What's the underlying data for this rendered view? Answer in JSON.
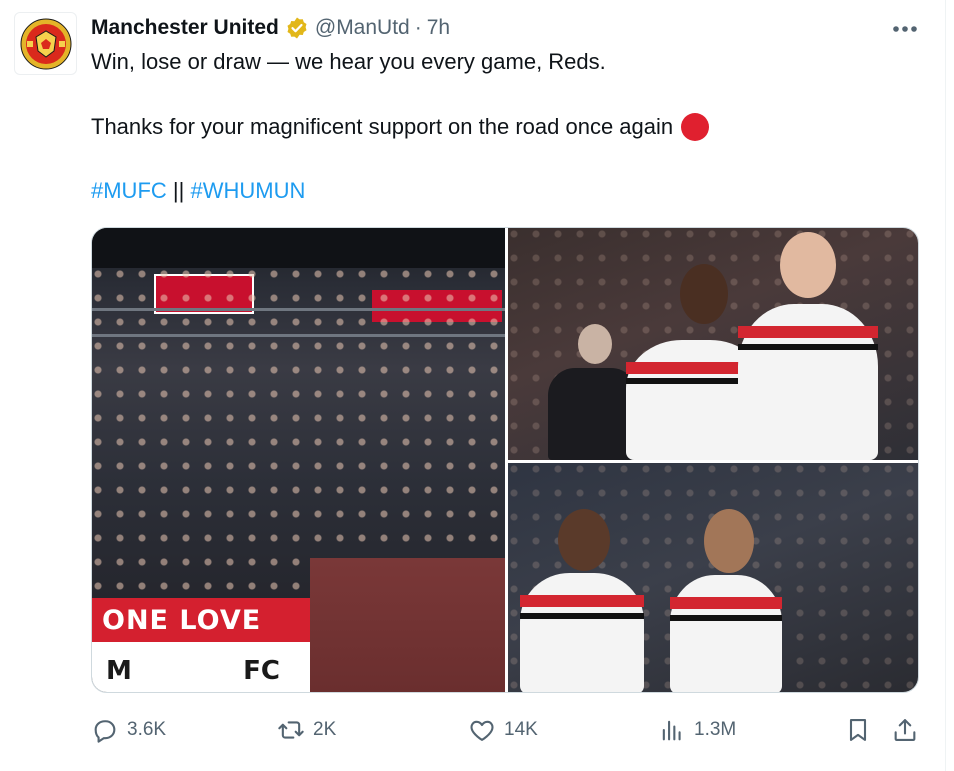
{
  "tweet": {
    "author_name": "Manchester United",
    "handle": "@ManUtd",
    "separator": "·",
    "time": "7h",
    "line1": "Win, lose or draw — we hear you every game, Reds.",
    "line2": "Thanks for your magnificent support on the road once again",
    "hashtag1": "#MUFC",
    "hashtag_separator": "||",
    "hashtag2": "#WHUMUN"
  },
  "media": {
    "banner_line1": "ONE LOVE",
    "banner_line2_left": "M",
    "banner_line2_right": "FC"
  },
  "actions": {
    "replies": "3.6K",
    "reposts": "2K",
    "likes": "14K",
    "views": "1.3M"
  },
  "colors": {
    "accent": "#1d9bf0",
    "verified_badge": "#e2b719",
    "heart_emoji": "#e0202f",
    "muted_text": "#536471"
  }
}
